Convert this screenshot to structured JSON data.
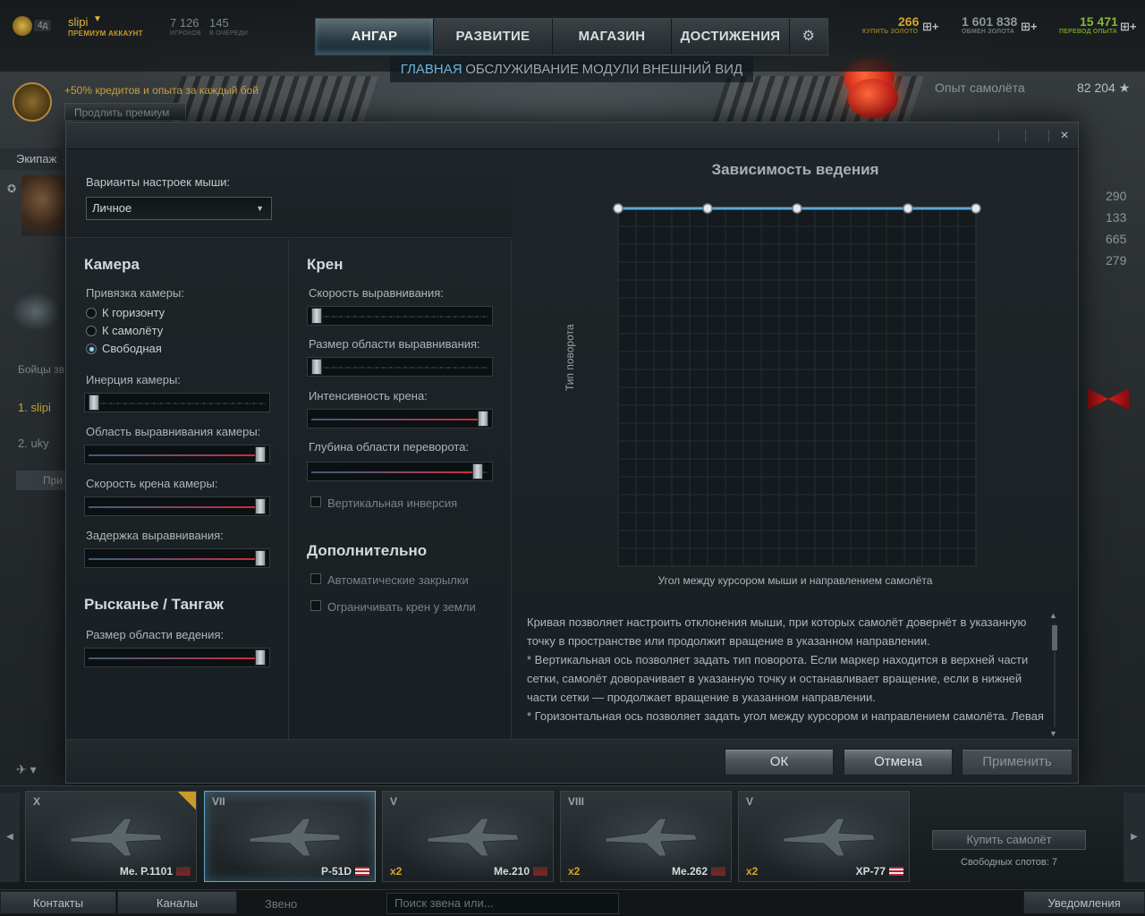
{
  "top_bar": {
    "user_level": "4д",
    "user_name": "slipi",
    "premium_label": "ПРЕМИУМ АККАУНТ",
    "players_count": "7 126",
    "players_label": "ИГРОКОВ",
    "queue_count": "145",
    "queue_label": "В ОЧЕРЕДИ",
    "gold_value": "266",
    "gold_label": "КУПИТЬ ЗОЛОТО",
    "exchange_value": "1 601 838",
    "exchange_label": "ОБМЕН ЗОЛОТА",
    "transfer_value": "15 471",
    "transfer_label": "ПЕРЕВОД ОПЫТА"
  },
  "main_tabs": [
    "АНГАР",
    "РАЗВИТИЕ",
    "МАГАЗИН",
    "ДОСТИЖЕНИЯ"
  ],
  "sub_tabs": [
    "ГЛАВНАЯ",
    "ОБСЛУЖИВАНИЕ",
    "МОДУЛИ",
    "ВНЕШНИЙ ВИД"
  ],
  "left_panel": {
    "premium_bonus": "+50% кредитов и опыта за каждый бой",
    "extend_premium": "Продлить премиум",
    "crew_label": "Экипаж",
    "fighters_label": "Бойцы зв",
    "fighter_1": "1. slipi",
    "fighter_2": "2. uky",
    "button_partial": "При"
  },
  "right_panel": {
    "plane_xp_label": "Опыт самолёта",
    "plane_xp_value": "82 204 ★",
    "stats": [
      "290",
      "133",
      "665",
      "279"
    ]
  },
  "dialog": {
    "close_glyph": "×",
    "presets_label": "Варианты настроек мыши:",
    "presets_value": "Личное",
    "camera": {
      "title": "Камера",
      "binding_label": "Привязка камеры:",
      "options": [
        "К горизонту",
        "К самолёту",
        "Свободная"
      ],
      "selected_index": 2,
      "sliders": [
        {
          "label": "Инерция камеры:",
          "value": 0.0
        },
        {
          "label": "Область выравнивания камеры:",
          "value": 1.0
        },
        {
          "label": "Скорость крена камеры:",
          "value": 1.0
        },
        {
          "label": "Задержка выравнивания:",
          "value": 1.0
        }
      ]
    },
    "yaw_pitch": {
      "title": "Рысканье / Тангаж",
      "sliders": [
        {
          "label": "Размер области ведения:",
          "value": 1.0
        }
      ]
    },
    "roll": {
      "title": "Крен",
      "sliders": [
        {
          "label": "Скорость выравнивания:",
          "value": 0.0
        },
        {
          "label": "Размер области выравнивания:",
          "value": 0.0
        },
        {
          "label": "Интенсивность крена:",
          "value": 1.0
        },
        {
          "label": "Глубина области переворота:",
          "value": 0.97
        }
      ],
      "vertical_inversion": "Вертикальная инверсия"
    },
    "extra": {
      "title": "Дополнительно",
      "checkboxes": [
        "Автоматические закрылки",
        "Ограничивать крен у земли"
      ]
    },
    "chart_data": {
      "type": "line",
      "title": "Зависимость ведения",
      "xlabel": "Угол между курсором мыши и направлением самолёта",
      "ylabel": "Тип поворота",
      "x": [
        0,
        0.25,
        0.5,
        0.81,
        1.0
      ],
      "values": [
        1,
        1,
        1,
        1,
        1
      ],
      "xlim": [
        0,
        1
      ],
      "ylim": [
        0,
        1
      ],
      "grid": true,
      "line_color": "#5aa8d8"
    },
    "help_text": [
      "Кривая позволяет настроить отклонения мыши, при которых самолёт довернёт в указанную",
      "точку в пространстве или продолжит вращение в указанном направлении.",
      "* Вертикальная ось позволяет задать тип поворота. Если маркер находится в верхней части",
      "сетки, самолёт доворачивает в указанную точку и останавливает вращение, если в нижней",
      "части сетки — продолжает вращение в указанном направлении.",
      "* Горизонтальная ось позволяет задать угол между курсором и направлением самолёта. Левая"
    ],
    "buttons": {
      "ok": "ОК",
      "cancel": "Отмена",
      "apply": "Применить"
    }
  },
  "carousel": {
    "planes": [
      {
        "tier": "X",
        "name": "Me. P.1101",
        "flag": "de",
        "mult": "",
        "premium": true,
        "selected": false
      },
      {
        "tier": "VII",
        "name": "P-51D",
        "flag": "us",
        "mult": "",
        "premium": false,
        "selected": true
      },
      {
        "tier": "V",
        "name": "Me.210",
        "flag": "de",
        "mult": "x2",
        "premium": false,
        "selected": false
      },
      {
        "tier": "VIII",
        "name": "Me.262",
        "flag": "de",
        "mult": "x2",
        "premium": false,
        "selected": false
      },
      {
        "tier": "V",
        "name": "XP-77",
        "flag": "us",
        "mult": "x2",
        "premium": false,
        "selected": false
      }
    ],
    "buy_plane": "Купить самолёт",
    "free_slots": "Свободных слотов: 7"
  },
  "bottom_bar": {
    "contacts": "Контакты",
    "channels": "Каналы",
    "squad_label": "Звено",
    "squad_search_placeholder": "Поиск звена или...",
    "notifications": "Уведомления"
  }
}
